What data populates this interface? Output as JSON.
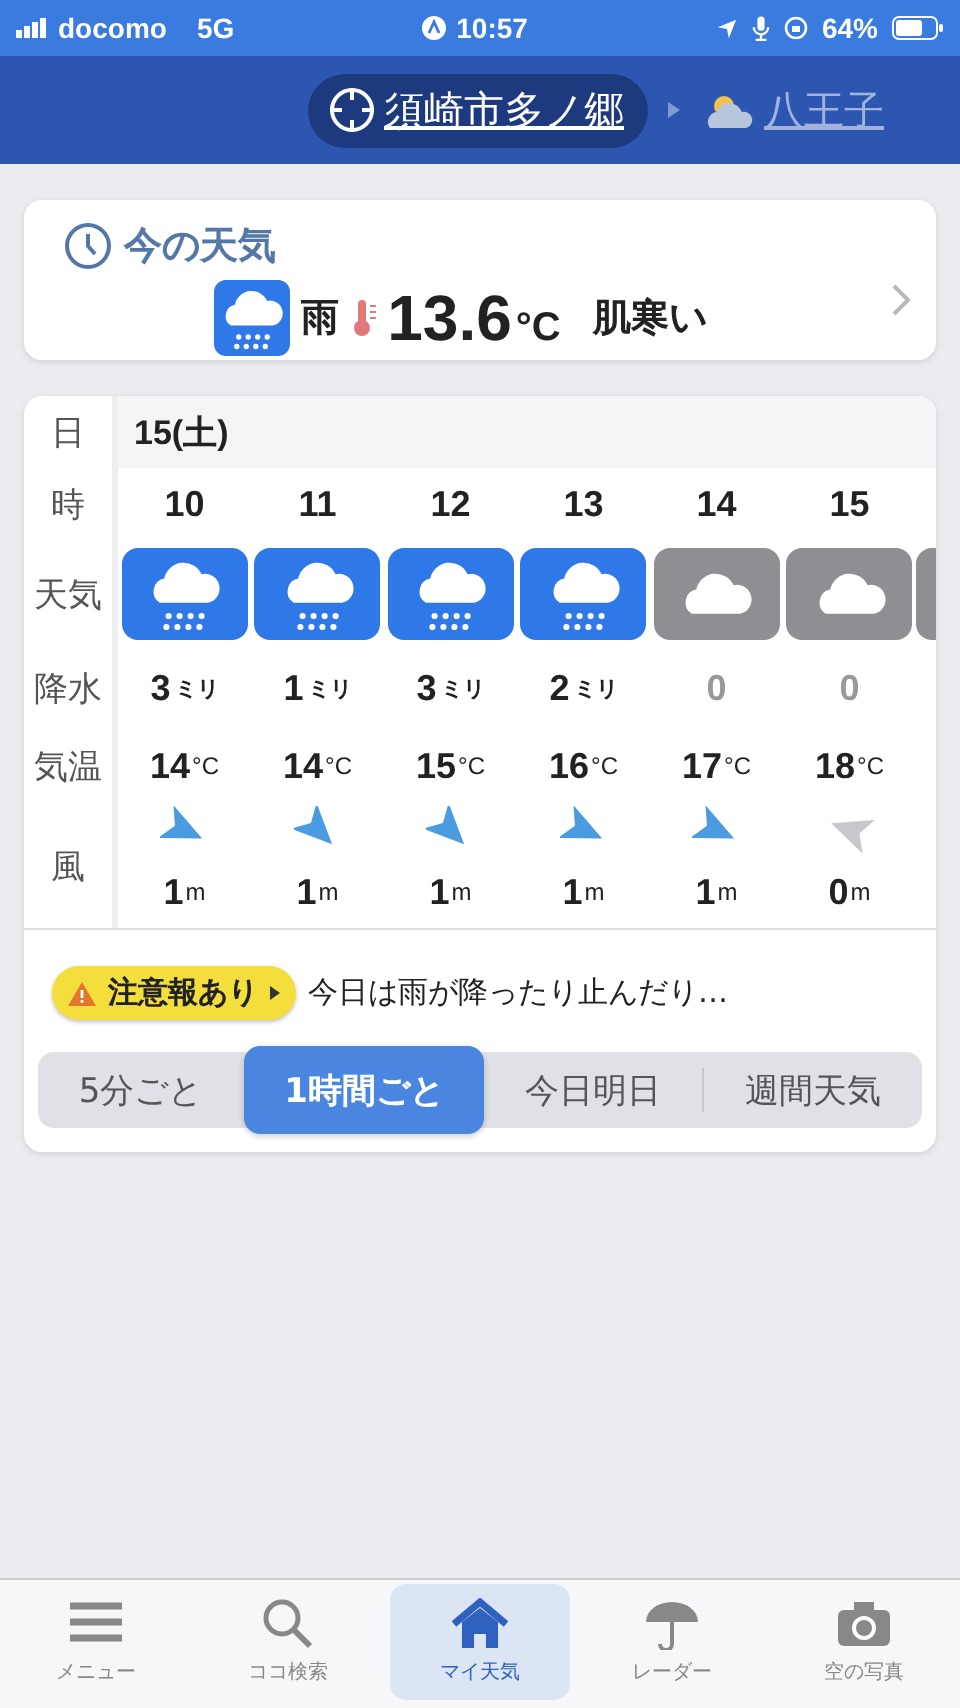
{
  "status_bar": {
    "carrier": "docomo",
    "network": "5G",
    "time": "10:57",
    "battery": "64%"
  },
  "locations": [
    {
      "name": "須崎市多ノ郷",
      "selected": true,
      "kind": "current"
    },
    {
      "name": "八王子",
      "selected": false,
      "kind": "weather"
    }
  ],
  "now": {
    "title": "今の天気",
    "weather": {
      "kind": "rain",
      "label": "雨"
    },
    "temperature": "13.6",
    "unit": "°C",
    "feeling": "肌寒い"
  },
  "hourly": {
    "row_labels": [
      "日",
      "時",
      "天気",
      "降水",
      "気温",
      "風"
    ],
    "date": "15(土)",
    "columns": [
      {
        "hour": "10",
        "kind": "rain",
        "precip": "3",
        "precip_unit": "ミリ",
        "temp": "14",
        "temp_unit": "°C",
        "wind": {
          "kind": "ese",
          "speed": "1",
          "unit": "m"
        }
      },
      {
        "hour": "11",
        "kind": "rain",
        "precip": "1",
        "precip_unit": "ミリ",
        "temp": "14",
        "temp_unit": "°C",
        "wind": {
          "kind": "se",
          "speed": "1",
          "unit": "m"
        }
      },
      {
        "hour": "12",
        "kind": "rain",
        "precip": "3",
        "precip_unit": "ミリ",
        "temp": "15",
        "temp_unit": "°C",
        "wind": {
          "kind": "se",
          "speed": "1",
          "unit": "m"
        }
      },
      {
        "hour": "13",
        "kind": "rain",
        "precip": "2",
        "precip_unit": "ミリ",
        "temp": "16",
        "temp_unit": "°C",
        "wind": {
          "kind": "ese",
          "speed": "1",
          "unit": "m"
        }
      },
      {
        "hour": "14",
        "kind": "cloudy",
        "precip": "0",
        "temp": "17",
        "temp_unit": "°C",
        "wind": {
          "kind": "ese",
          "speed": "1",
          "unit": "m"
        }
      },
      {
        "hour": "15",
        "kind": "cloudy",
        "precip": "0",
        "temp": "18",
        "temp_unit": "°C",
        "wind": {
          "kind": "calm",
          "speed": "0",
          "unit": "m"
        }
      }
    ],
    "partial_tile": {
      "kind": "cloudy"
    }
  },
  "alert": {
    "badge": "注意報あり",
    "text": "今日は雨が降ったり止んだり…"
  },
  "modes": [
    {
      "label": "5分ごと",
      "selected": false
    },
    {
      "label": "1時間ごと",
      "selected": true
    },
    {
      "label": "今日明日",
      "selected": false
    },
    {
      "label": "週間天気",
      "selected": false
    }
  ],
  "nav": [
    {
      "label": "メニュー",
      "kind": "menu",
      "selected": false
    },
    {
      "label": "ココ検索",
      "kind": "search",
      "selected": false
    },
    {
      "label": "マイ天気",
      "kind": "home",
      "selected": true
    },
    {
      "label": "レーダー",
      "kind": "umbrella",
      "selected": false
    },
    {
      "label": "空の写真",
      "kind": "camera",
      "selected": false
    }
  ]
}
